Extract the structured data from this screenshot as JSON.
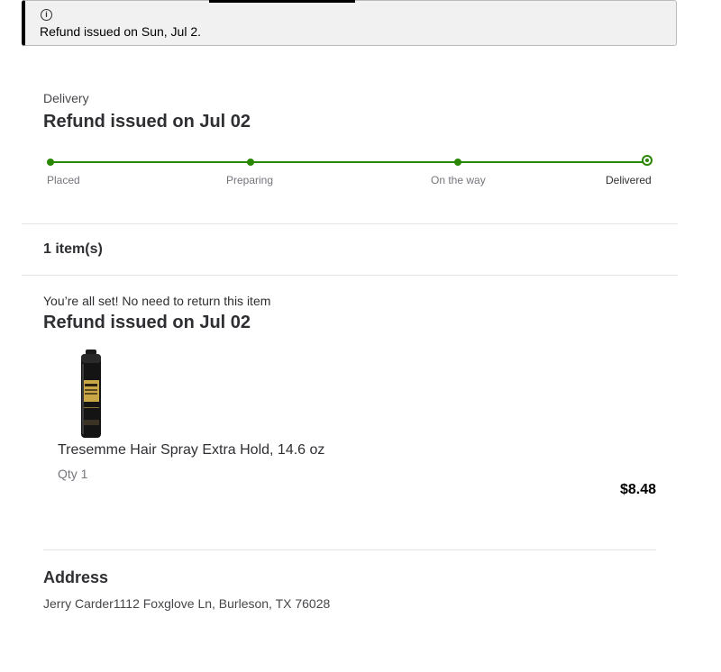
{
  "alert": {
    "icon": "info-icon",
    "icon_glyph": "i",
    "message": "Refund issued on Sun, Jul 2."
  },
  "delivery": {
    "eyebrow": "Delivery",
    "title": "Refund issued on Jul 02",
    "steps": [
      "Placed",
      "Preparing",
      "On the way",
      "Delivered"
    ],
    "current_step": "Delivered",
    "accent_color": "#2a8703"
  },
  "items": {
    "count_label": "1 item(s)",
    "return_note": "You’re all set! No need to return this item",
    "status_title": "Refund issued on Jul 02",
    "list": [
      {
        "name": "Tresemme Hair Spray Extra Hold, 14.6 oz",
        "qty": "Qty 1",
        "price": "$8.48",
        "image_icon": "hair-spray-can-image"
      }
    ]
  },
  "address": {
    "title": "Address",
    "text": "Jerry Carder1112 Foxglove Ln, Burleson, TX 76028"
  }
}
